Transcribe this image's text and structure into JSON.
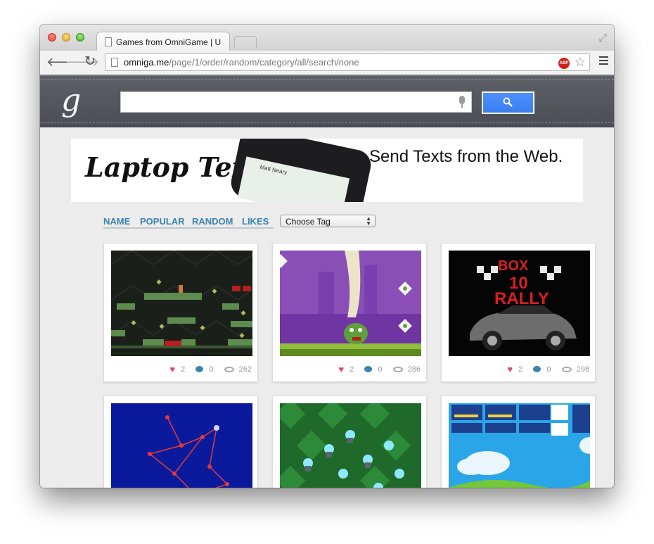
{
  "browser": {
    "tab_title": "Games from OmniGame | U",
    "url_host": "omniga.me",
    "url_path": "/page/1/order/random/category/all/search/none",
    "abp_label": "ABP"
  },
  "site": {
    "logo": "g",
    "search_value": ""
  },
  "ad": {
    "logo_text": "Laptop Text",
    "tagline": "Send Texts from the Web.",
    "phone_contact": "Matt Neary"
  },
  "sort": {
    "links": [
      "NAME",
      "POPULAR",
      "RANDOM",
      "LIKES"
    ],
    "tag_select": "Choose Tag"
  },
  "games": [
    {
      "likes": "2",
      "comments": "0",
      "views": "262",
      "thumb": "platformer-dark"
    },
    {
      "likes": "2",
      "comments": "0",
      "views": "286",
      "thumb": "purple-monster"
    },
    {
      "likes": "2",
      "comments": "0",
      "views": "298",
      "thumb": "box10-rally"
    },
    {
      "likes": "",
      "comments": "",
      "views": "",
      "thumb": "constellation"
    },
    {
      "likes": "",
      "comments": "",
      "views": "",
      "thumb": "green-towers"
    },
    {
      "likes": "",
      "comments": "",
      "views": "",
      "thumb": "sky-menu"
    }
  ],
  "colors": {
    "header": "#54575d",
    "search_button": "#4389f8",
    "link": "#3b82b0",
    "heart": "#e0457a"
  }
}
